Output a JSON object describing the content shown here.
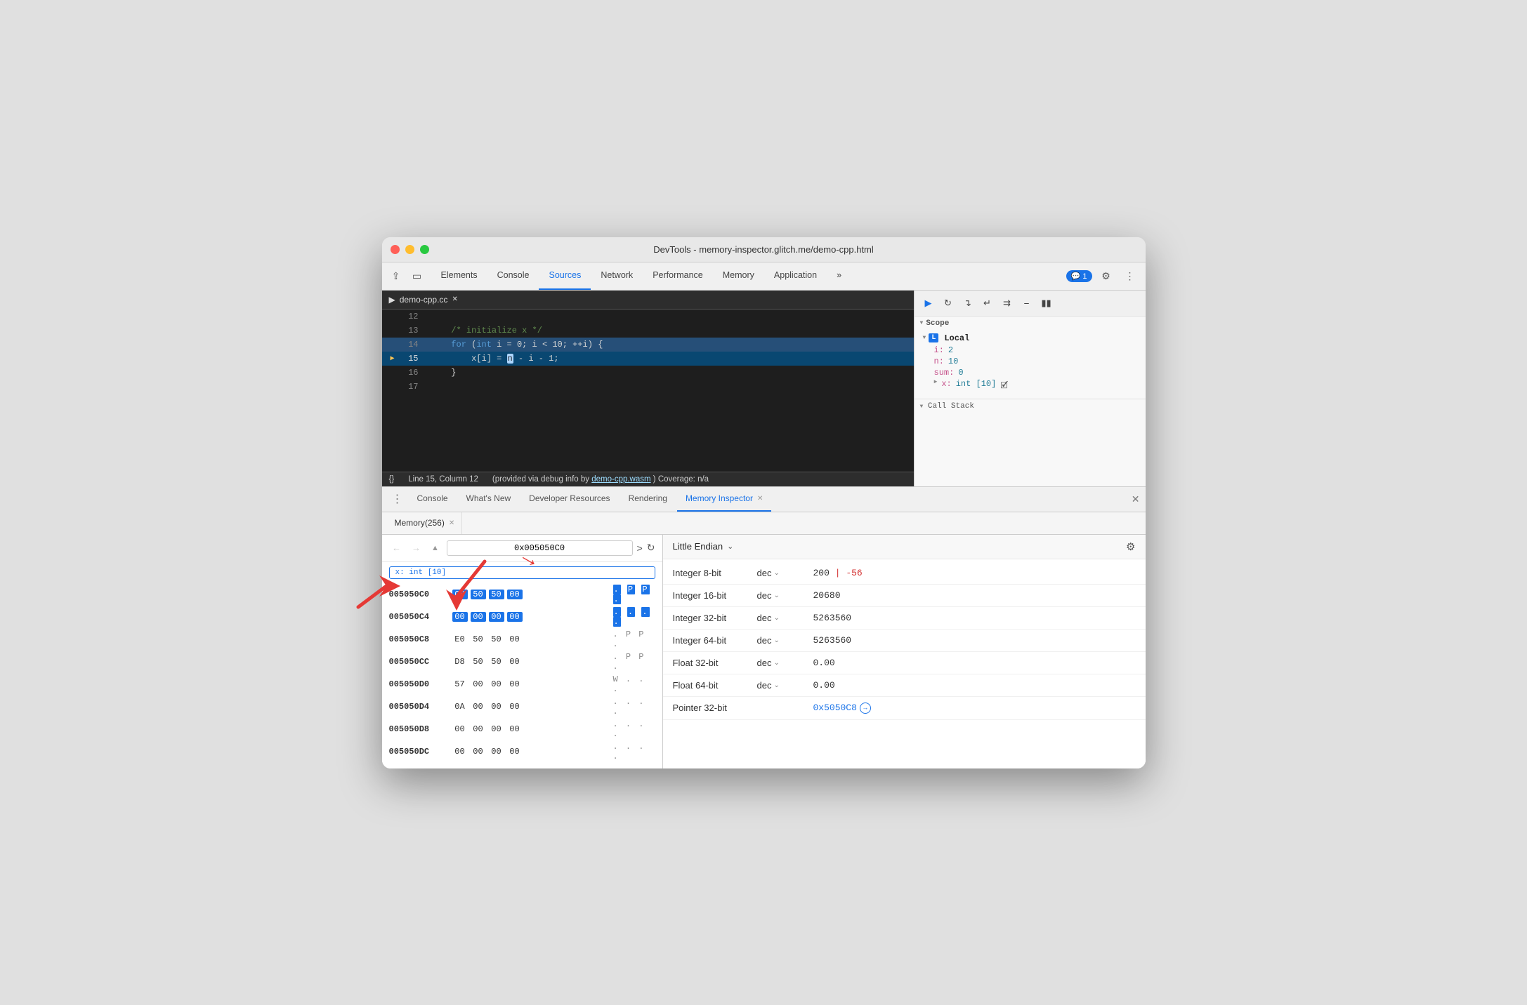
{
  "window": {
    "title": "DevTools - memory-inspector.glitch.me/demo-cpp.html"
  },
  "header": {
    "tabs": [
      {
        "label": "Elements",
        "active": false
      },
      {
        "label": "Console",
        "active": false
      },
      {
        "label": "Sources",
        "active": true
      },
      {
        "label": "Network",
        "active": false
      },
      {
        "label": "Performance",
        "active": false
      },
      {
        "label": "Memory",
        "active": false
      },
      {
        "label": "Application",
        "active": false
      }
    ],
    "more_label": "»",
    "console_count": "1",
    "settings_label": "⚙",
    "more_menu_label": "⋮"
  },
  "sources": {
    "file_tab": "demo-cpp.cc",
    "lines": [
      {
        "num": "12",
        "content": "",
        "highlighted": false
      },
      {
        "num": "13",
        "content": "    /* initialize x */",
        "highlighted": false
      },
      {
        "num": "14",
        "content": "    for (int i = 0; i < 10; ++i) {",
        "highlighted": true
      },
      {
        "num": "15",
        "content": "        x[i] = n - i - 1;",
        "highlighted": true,
        "cursor": true
      },
      {
        "num": "16",
        "content": "    }",
        "highlighted": false
      },
      {
        "num": "17",
        "content": "",
        "highlighted": false
      }
    ],
    "status": {
      "prefix": "{}",
      "position": "Line 15, Column 12",
      "debug_info": "(provided via debug info by",
      "debug_link": "demo-cpp.wasm",
      "coverage": ") Coverage: n/a"
    }
  },
  "scope": {
    "header": "Scope",
    "local_label": "Local",
    "vars": [
      {
        "name": "i:",
        "value": "2"
      },
      {
        "name": "n:",
        "value": "10"
      },
      {
        "name": "sum:",
        "value": "0"
      },
      {
        "name": "x:",
        "value": "int [10]",
        "icon": "📍"
      }
    ],
    "call_stack_label": "Call Stack"
  },
  "bottom_tabs": {
    "tabs": [
      {
        "label": "Console",
        "active": false,
        "closable": false
      },
      {
        "label": "What's New",
        "active": false,
        "closable": false
      },
      {
        "label": "Developer Resources",
        "active": false,
        "closable": false
      },
      {
        "label": "Rendering",
        "active": false,
        "closable": false
      },
      {
        "label": "Memory Inspector",
        "active": true,
        "closable": true
      }
    ]
  },
  "memory_tab": {
    "label": "Memory(256)",
    "closable": true
  },
  "hex_viewer": {
    "nav_back_disabled": true,
    "nav_forward_disabled": true,
    "address": "0x005050C0",
    "tag": "x: int [10]",
    "rows": [
      {
        "addr": "005050C0",
        "bytes": [
          "C8",
          "50",
          "50",
          "00"
        ],
        "ascii": ". P P .",
        "highlighted": true
      },
      {
        "addr": "005050C4",
        "bytes": [
          "00",
          "00",
          "00",
          "00"
        ],
        "ascii": ". . . .",
        "highlighted": true
      },
      {
        "addr": "005050C8",
        "bytes": [
          "E0",
          "50",
          "50",
          "00"
        ],
        "ascii": ". P P .",
        "highlighted": false
      },
      {
        "addr": "005050CC",
        "bytes": [
          "D8",
          "50",
          "50",
          "00"
        ],
        "ascii": ". P P .",
        "highlighted": false
      },
      {
        "addr": "005050D0",
        "bytes": [
          "57",
          "00",
          "00",
          "00"
        ],
        "ascii": "W . . .",
        "highlighted": false
      },
      {
        "addr": "005050D4",
        "bytes": [
          "0A",
          "00",
          "00",
          "00"
        ],
        "ascii": ". . . .",
        "highlighted": false
      },
      {
        "addr": "005050D8",
        "bytes": [
          "00",
          "00",
          "00",
          "00"
        ],
        "ascii": ". . . .",
        "highlighted": false
      },
      {
        "addr": "005050DC",
        "bytes": [
          "00",
          "00",
          "00",
          "00"
        ],
        "ascii": ". . . .",
        "highlighted": false
      }
    ]
  },
  "interpreter": {
    "endian": "Little Endian",
    "rows": [
      {
        "label": "Integer 8-bit",
        "format": "dec",
        "value": "200",
        "neg_value": "-56"
      },
      {
        "label": "Integer 16-bit",
        "format": "dec",
        "value": "20680"
      },
      {
        "label": "Integer 32-bit",
        "format": "dec",
        "value": "5263560"
      },
      {
        "label": "Integer 64-bit",
        "format": "dec",
        "value": "5263560"
      },
      {
        "label": "Float 32-bit",
        "format": "dec",
        "value": "0.00"
      },
      {
        "label": "Float 64-bit",
        "format": "dec",
        "value": "0.00"
      },
      {
        "label": "Pointer 32-bit",
        "format": "",
        "value": "0x5050C8",
        "is_pointer": true
      }
    ]
  }
}
